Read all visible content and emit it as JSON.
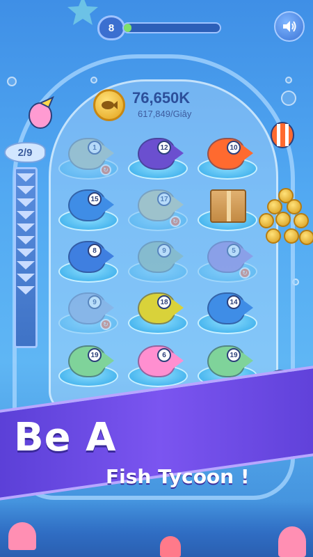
{
  "hud": {
    "level": "8",
    "level_progress": 0.08,
    "coins": "76,650K",
    "coin_rate": "617,849/Giây",
    "slot_counter": "2/9"
  },
  "board": {
    "cells": [
      {
        "type": "fish",
        "level": "1",
        "ghost": true,
        "swap": true,
        "color": "#b8c7a8"
      },
      {
        "type": "fish",
        "level": "12",
        "ghost": false,
        "swap": false,
        "color": "#6b4fcf"
      },
      {
        "type": "fish",
        "level": "10",
        "ghost": false,
        "swap": false,
        "color": "#ff6a2f"
      },
      {
        "type": "fish",
        "level": "15",
        "ghost": false,
        "swap": false,
        "color": "#3f8de6"
      },
      {
        "type": "fish",
        "level": "17",
        "ghost": true,
        "swap": true,
        "color": "#c7c79a"
      },
      {
        "type": "crate",
        "level": "",
        "ghost": false,
        "swap": false,
        "color": "#c38a44"
      },
      {
        "type": "fish",
        "level": "8",
        "ghost": false,
        "swap": false,
        "color": "#3f7fe0"
      },
      {
        "type": "fish",
        "level": "9",
        "ghost": true,
        "swap": false,
        "color": "#8fb5a0"
      },
      {
        "type": "fish",
        "level": "5",
        "ghost": true,
        "swap": true,
        "color": "#9a7ad6"
      },
      {
        "type": "fish",
        "level": "9",
        "ghost": true,
        "swap": true,
        "color": "#8fa6d6"
      },
      {
        "type": "fish",
        "level": "18",
        "ghost": false,
        "swap": false,
        "color": "#d9d23a"
      },
      {
        "type": "fish",
        "level": "14",
        "ghost": false,
        "swap": false,
        "color": "#3f8de6"
      },
      {
        "type": "fish",
        "level": "19",
        "ghost": false,
        "swap": false,
        "color": "#7fd39a"
      },
      {
        "type": "fish",
        "level": "6",
        "ghost": false,
        "swap": false,
        "color": "#ff8fd0"
      },
      {
        "type": "fish",
        "level": "19",
        "ghost": false,
        "swap": false,
        "color": "#7fd39a"
      }
    ]
  },
  "banner": {
    "line1": "Be A",
    "line2": "Fish Tycoon !"
  },
  "colors": {
    "accent": "#7b55f0",
    "coin": "#e3a21a",
    "progress": "#7fe06a"
  },
  "icons": {
    "sound": "speaker-icon",
    "coin": "coin-fish-icon"
  }
}
